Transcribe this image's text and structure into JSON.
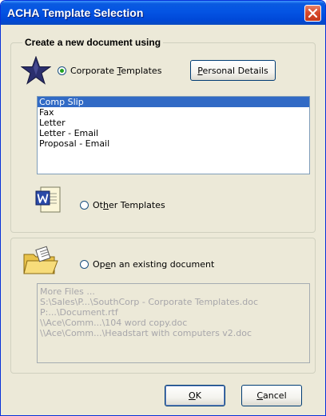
{
  "window": {
    "title": "ACHA Template Selection"
  },
  "group_new": {
    "label": "Create a new document using",
    "corporate_radio": {
      "pre": "Corporate ",
      "accel": "T",
      "post": "emplates",
      "checked": true
    },
    "personal_button": {
      "pre": "",
      "accel": "P",
      "post": "ersonal Details"
    },
    "templates": [
      "Comp Slip",
      "Fax",
      "Letter",
      "Letter - Email",
      "Proposal - Email"
    ],
    "selected_index": 0,
    "other_radio": {
      "pre": "Ot",
      "accel": "h",
      "post": "er Templates",
      "checked": false
    }
  },
  "group_open": {
    "open_radio": {
      "pre": "Op",
      "accel": "e",
      "post": "n an existing document",
      "checked": false
    },
    "recent_files": [
      "More Files ...",
      "S:\\Sales\\P...\\SouthCorp - Corporate Templates.doc",
      "P:...\\Document.rtf",
      "\\\\Ace\\Comm...\\104 word copy.doc",
      "\\\\Ace\\Comm...\\Headstart with computers v2.doc"
    ]
  },
  "buttons": {
    "ok": {
      "pre": "",
      "accel": "O",
      "post": "K"
    },
    "cancel": {
      "pre": "",
      "accel": "C",
      "post": "ancel"
    }
  },
  "icons": {
    "star": "star-icon",
    "word": "word-document-icon",
    "folder": "open-folder-icon",
    "close": "close-icon"
  },
  "colors": {
    "titlebar": "#0454e3",
    "selection": "#316ac5",
    "close": "#d84a2c",
    "dialog_bg": "#ece9d8"
  }
}
